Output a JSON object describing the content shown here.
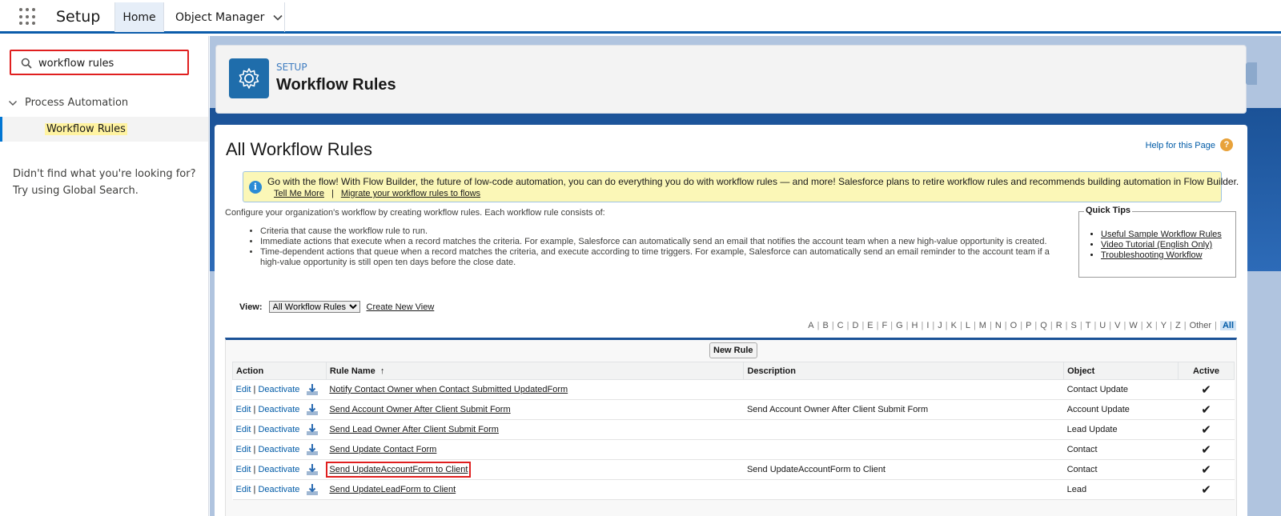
{
  "header": {
    "app_name": "Setup",
    "tabs": [
      {
        "label": "Home"
      },
      {
        "label": "Object Manager"
      }
    ]
  },
  "sidebar": {
    "search": {
      "value": "workflow rules"
    },
    "tree": {
      "group": "Process Automation",
      "item": "Workflow Rules"
    },
    "not_found_line1": "Didn't find what you're looking for?",
    "not_found_line2": "Try using Global Search."
  },
  "page_header": {
    "kicker": "SETUP",
    "title": "Workflow Rules"
  },
  "content": {
    "title": "All Workflow Rules",
    "help_link": "Help for this Page",
    "help_icon": "?",
    "banner": {
      "message": "Go with the flow! With Flow Builder, the future of low-code automation, you can do everything you do with workflow rules — and more! Salesforce plans to retire workflow rules and recommends building automation in Flow Builder.",
      "link1": "Tell Me More",
      "separator": "|",
      "link2": "Migrate your workflow rules to flows"
    },
    "intro": "Configure your organization's workflow by creating workflow rules. Each workflow rule consists of:",
    "bullets": [
      "Criteria that cause the workflow rule to run.",
      "Immediate actions that execute when a record matches the criteria. For example, Salesforce can automatically send an email that notifies the account team when a new high-value opportunity is created.",
      "Time-dependent actions that queue when a record matches the criteria, and execute according to time triggers. For example, Salesforce can automatically send an email reminder to the account team if a high-value opportunity is still open ten days before the close date."
    ],
    "quick_tips": {
      "title": "Quick Tips",
      "links": [
        "Useful Sample Workflow Rules",
        "Video Tutorial (English Only)",
        "Troubleshooting Workflow"
      ]
    },
    "view": {
      "label": "View:",
      "selected": "All Workflow Rules",
      "create_link": "Create New View"
    },
    "alpha_filter": [
      "A",
      "B",
      "C",
      "D",
      "E",
      "F",
      "G",
      "H",
      "I",
      "J",
      "K",
      "L",
      "M",
      "N",
      "O",
      "P",
      "Q",
      "R",
      "S",
      "T",
      "U",
      "V",
      "W",
      "X",
      "Y",
      "Z",
      "Other",
      "All"
    ],
    "new_rule_button": "New Rule",
    "table": {
      "columns": {
        "action": "Action",
        "rule_name": "Rule Name",
        "sort_arrow": "↑",
        "description": "Description",
        "object": "Object",
        "active": "Active"
      },
      "edit_label": "Edit",
      "sep": "|",
      "deactivate_label": "Deactivate",
      "check": "✔",
      "rows": [
        {
          "name": "Notify Contact Owner when Contact Submitted UpdatedForm",
          "description": "",
          "object": "Contact Update"
        },
        {
          "name": "Send Account Owner After Client Submit Form",
          "description": "Send Account Owner After Client Submit Form",
          "object": "Account Update"
        },
        {
          "name": "Send Lead Owner After Client Submit Form",
          "description": "",
          "object": "Lead Update"
        },
        {
          "name": "Send Update Contact Form",
          "description": "",
          "object": "Contact"
        },
        {
          "name": "Send UpdateAccountForm to Client",
          "description": "Send UpdateAccountForm to Client",
          "object": "Contact"
        },
        {
          "name": "Send UpdateLeadForm to Client",
          "description": "",
          "object": "Lead"
        }
      ]
    }
  }
}
